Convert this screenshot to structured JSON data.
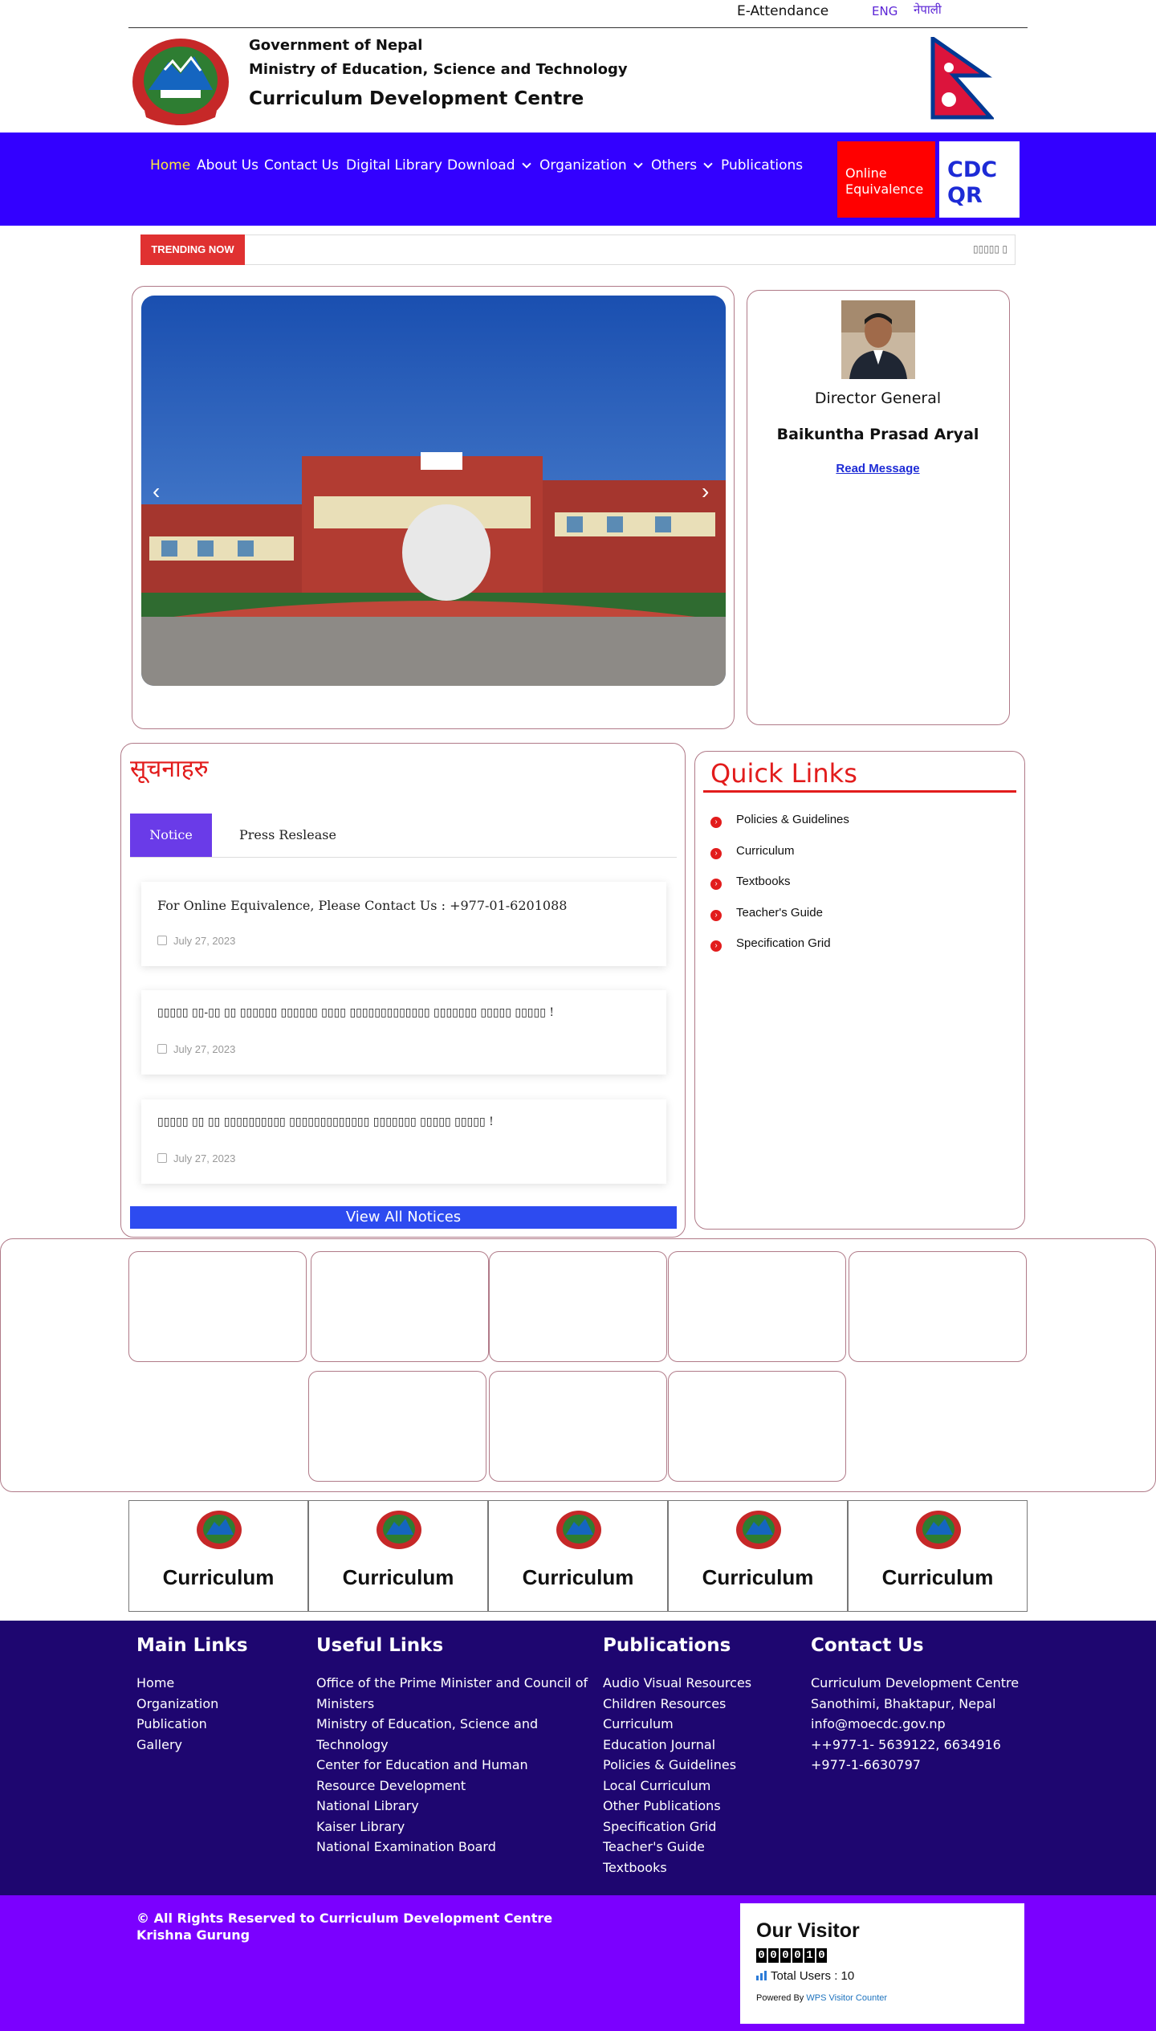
{
  "topbar": {
    "attendance": "E-Attendance",
    "lang_eng": "ENG",
    "lang_nep": "नेपाली"
  },
  "header": {
    "line1": "Government of Nepal",
    "line2": "Ministry of Education, Science and Technology",
    "line3": "Curriculum Development Centre"
  },
  "nav": {
    "items": [
      "Home",
      "About Us",
      "Contact Us",
      "Digital Library",
      "Download",
      "Organization",
      "Others",
      "Publications"
    ],
    "equivalence": "Online Equivalence",
    "qr": "CDC QR"
  },
  "trending": {
    "label": "TRENDING NOW",
    "text": "▯▯▯▯▯ ▯"
  },
  "director": {
    "title": "Director General",
    "name": "Baikuntha Prasad Aryal",
    "read": "Read Message"
  },
  "notices": {
    "title": "सूचनाहरु",
    "tabs": [
      "Notice",
      "Press Reslease"
    ],
    "items": [
      {
        "text": "For Online Equivalence, Please Contact Us : +977-01-6201088",
        "date": "July 27, 2023"
      },
      {
        "text": "▯▯▯▯▯ ▯▯-▯▯ ▯▯ ▯▯▯▯▯▯ ▯▯▯▯▯▯ ▯▯▯▯ ▯▯▯▯▯▯▯▯▯▯▯▯▯ ▯▯▯▯▯▯▯ ▯▯▯▯▯ ▯▯▯▯▯ !",
        "date": "July 27, 2023"
      },
      {
        "text": "▯▯▯▯▯ ▯▯ ▯▯ ▯▯▯▯▯▯▯▯▯▯ ▯▯▯▯▯▯▯▯▯▯▯▯▯ ▯▯▯▯▯▯▯ ▯▯▯▯▯ ▯▯▯▯▯ !",
        "date": "July 27, 2023"
      }
    ],
    "view_all": "View All Notices"
  },
  "quick_links": {
    "title": "Quick Links",
    "items": [
      "Policies & Guidelines",
      "Curriculum",
      "Textbooks",
      "Teacher's Guide",
      "Specification Grid"
    ]
  },
  "curriculum_boxes": [
    "Curriculum",
    "Curriculum",
    "Curriculum",
    "Curriculum",
    "Curriculum"
  ],
  "footer": {
    "main_links": {
      "title": "Main Links",
      "items": [
        "Home",
        "Organization",
        "Publication",
        "Gallery"
      ]
    },
    "useful_links": {
      "title": "Useful Links",
      "items": [
        "Office of the Prime Minister and Council of Ministers",
        "Ministry of Education, Science and Technology",
        "Center for Education and Human Resource Development",
        "National Library",
        "Kaiser Library",
        "National Examination Board"
      ]
    },
    "publications": {
      "title": "Publications",
      "items": [
        "Audio Visual Resources",
        "Children Resources",
        "Curriculum",
        "Education Journal",
        "Policies & Guidelines",
        "Local Curriculum",
        "Other Publications",
        "Specification Grid",
        "Teacher's Guide",
        "Textbooks"
      ]
    },
    "contact": {
      "title": "Contact Us",
      "items": [
        "Curriculum Development Centre",
        "Sanothimi, Bhaktapur, Nepal",
        "info@moecdc.gov.np",
        "++977-1- 5639122, 6634916",
        "+977-1-6630797"
      ]
    }
  },
  "bottom": {
    "copyright": "© All Rights Reserved to Curriculum Development Centre",
    "author": "Krishna Gurung",
    "visitor": {
      "title": "Our Visitor",
      "digits": [
        "0",
        "0",
        "0",
        "0",
        "1",
        "0"
      ],
      "total": "Total Users : 10",
      "powered": "Powered By",
      "powered_link": "WPS Visitor Counter"
    }
  },
  "colors": {
    "nav": "#3300ff",
    "footer": "#1e0670",
    "bottom": "#7b00ff",
    "accent_red": "#e21c1c"
  }
}
